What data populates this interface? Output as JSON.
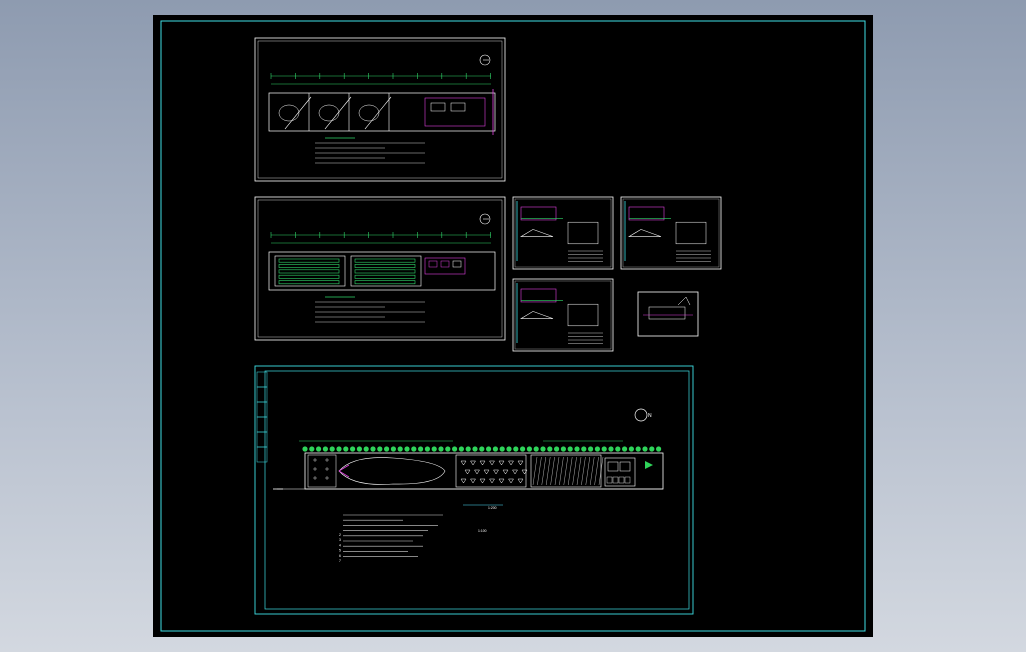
{
  "app": {
    "title": "",
    "canvas_background": "#000000",
    "desktop_gradient": [
      "#8e9bb0",
      "#d3d8e0"
    ]
  },
  "colors": {
    "frame": "#3fe0e6",
    "linework": "#ffffff",
    "dimension": "#31d86a",
    "hatch": "#31d86a",
    "accent": "#e040e0",
    "cyan_text": "#4fe3ff",
    "plants": "#2fd45a"
  },
  "sheets": [
    {
      "id": "sheet-top-plan",
      "kind": "large"
    },
    {
      "id": "sheet-mid-plan",
      "kind": "large"
    },
    {
      "id": "sheet-detail-a",
      "kind": "small"
    },
    {
      "id": "sheet-detail-b",
      "kind": "small"
    },
    {
      "id": "sheet-detail-c",
      "kind": "small"
    },
    {
      "id": "sheet-detail-d",
      "kind": "small"
    },
    {
      "id": "sheet-landscape-plan",
      "kind": "main"
    }
  ],
  "text": {
    "scale_label": "1:200",
    "scale_label_b": "1:100",
    "north_symbol": "N"
  }
}
